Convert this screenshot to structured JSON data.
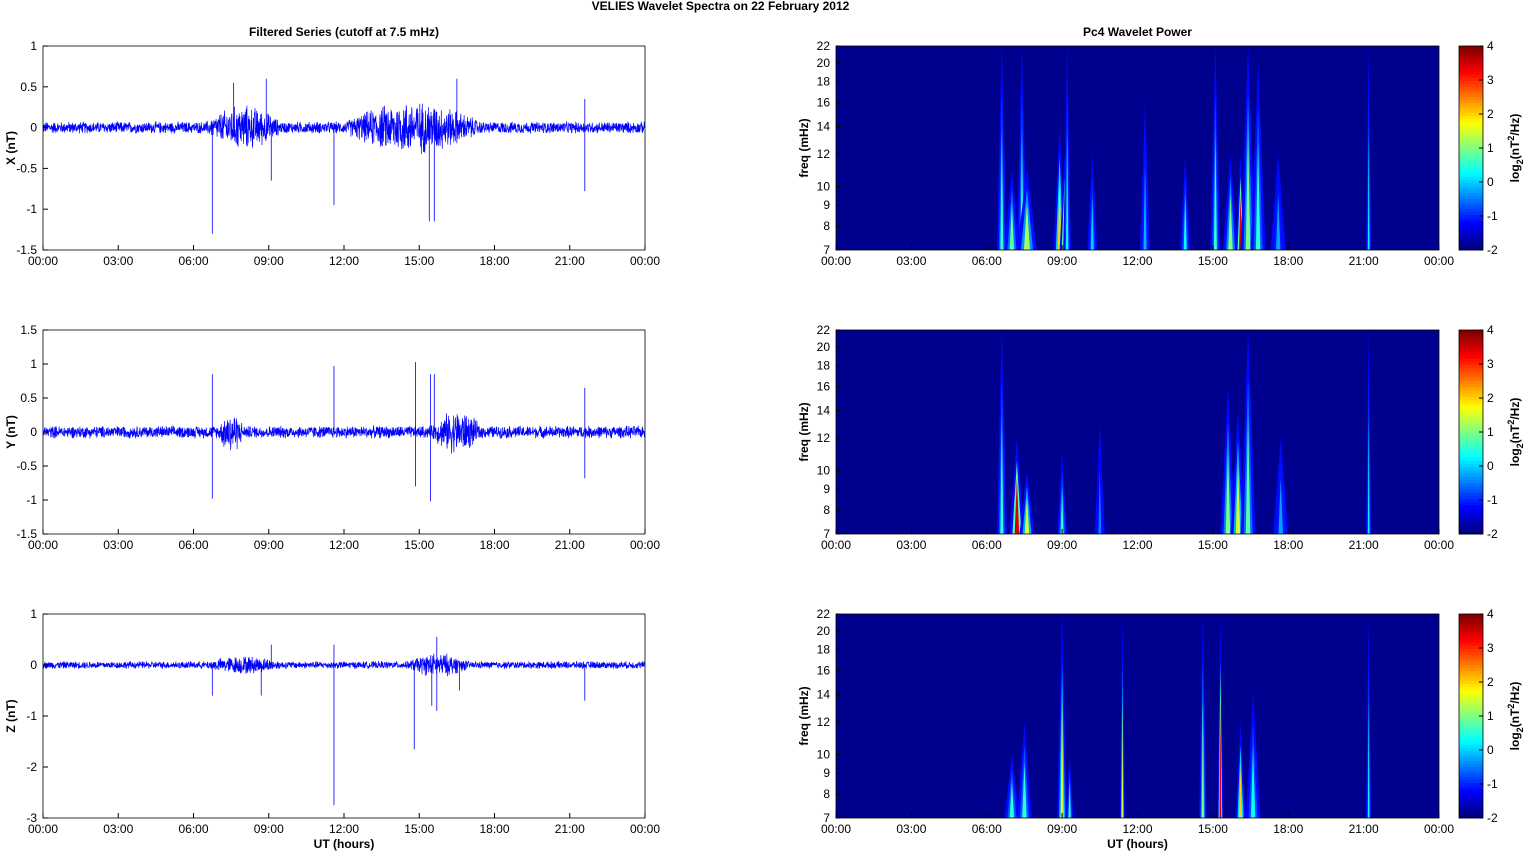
{
  "title": "VELIES Wavelet Spectra on 22 February  2012",
  "chart_data": [
    {
      "type": "line",
      "title": "Filtered Series (cutoff at 7.5 mHz)",
      "ylabel": "X (nT)",
      "xlabel": "",
      "xlim": [
        0,
        24
      ],
      "ylim": [
        -1.5,
        1
      ],
      "yticks": [
        -1.5,
        -1,
        -0.5,
        0,
        0.5,
        1
      ],
      "xticks": [
        "00:00",
        "03:00",
        "06:00",
        "09:00",
        "12:00",
        "15:00",
        "18:00",
        "21:00",
        "00:00"
      ],
      "color": "#0000ff",
      "noise": 0.08,
      "bursts": [
        [
          6.5,
          9.5,
          0.22
        ],
        [
          12,
          17.5,
          0.28
        ]
      ],
      "spikes": [
        [
          6.75,
          -1.3
        ],
        [
          7.6,
          0.55
        ],
        [
          8.9,
          0.6
        ],
        [
          9.1,
          -0.65
        ],
        [
          11.6,
          -0.95
        ],
        [
          15.4,
          -1.15
        ],
        [
          15.6,
          -1.15
        ],
        [
          16.5,
          0.6
        ],
        [
          21.6,
          -0.78
        ],
        [
          21.6,
          0.35
        ]
      ]
    },
    {
      "type": "line",
      "title": "",
      "ylabel": "Y (nT)",
      "xlabel": "",
      "xlim": [
        0,
        24
      ],
      "ylim": [
        -1.5,
        1.5
      ],
      "yticks": [
        -1.5,
        -1,
        -0.5,
        0,
        0.5,
        1,
        1.5
      ],
      "xticks": [
        "00:00",
        "03:00",
        "06:00",
        "09:00",
        "12:00",
        "15:00",
        "18:00",
        "21:00",
        "00:00"
      ],
      "color": "#0000ff",
      "noise": 0.1,
      "bursts": [
        [
          7,
          8,
          0.25
        ],
        [
          15.5,
          17.5,
          0.25
        ]
      ],
      "spikes": [
        [
          6.75,
          0.85
        ],
        [
          6.75,
          -0.98
        ],
        [
          11.6,
          0.97
        ],
        [
          14.85,
          1.03
        ],
        [
          14.85,
          -0.8
        ],
        [
          15.45,
          0.85
        ],
        [
          15.45,
          -1.02
        ],
        [
          15.6,
          0.85
        ],
        [
          21.6,
          0.65
        ],
        [
          21.6,
          -0.68
        ]
      ]
    },
    {
      "type": "line",
      "title": "",
      "ylabel": "Z (nT)",
      "xlabel": "UT (hours)",
      "xlim": [
        0,
        24
      ],
      "ylim": [
        -3,
        1
      ],
      "yticks": [
        -3,
        -2,
        -1,
        0,
        1
      ],
      "xticks": [
        "00:00",
        "03:00",
        "06:00",
        "09:00",
        "12:00",
        "15:00",
        "18:00",
        "21:00",
        "00:00"
      ],
      "color": "#0000ff",
      "noise": 0.08,
      "bursts": [
        [
          6.5,
          9.5,
          0.12
        ],
        [
          14.5,
          17,
          0.18
        ]
      ],
      "spikes": [
        [
          6.75,
          -0.6
        ],
        [
          8.7,
          -0.6
        ],
        [
          9.1,
          0.4
        ],
        [
          11.6,
          -2.75
        ],
        [
          11.6,
          0.4
        ],
        [
          14.8,
          -1.65
        ],
        [
          15.5,
          -0.8
        ],
        [
          15.7,
          -0.9
        ],
        [
          15.7,
          0.55
        ],
        [
          16.6,
          -0.5
        ],
        [
          21.6,
          -0.7
        ]
      ]
    },
    {
      "type": "heatmap",
      "title": "Pc4 Wavelet Power",
      "ylabel": "freq (mHz)",
      "xlabel": "",
      "xlim": [
        0,
        24
      ],
      "ylim": [
        7,
        22
      ],
      "yscale": "log",
      "yticks": [
        7,
        8,
        9,
        10,
        12,
        14,
        16,
        18,
        20,
        22
      ],
      "xticks": [
        "00:00",
        "03:00",
        "06:00",
        "09:00",
        "12:00",
        "15:00",
        "18:00",
        "21:00",
        "00:00"
      ],
      "colorbar": {
        "label": "log2(nT^2/Hz)",
        "range": [
          -2,
          4
        ],
        "ticks": [
          -2,
          -1,
          0,
          1,
          2,
          3,
          4
        ]
      },
      "events": [
        [
          6.6,
          22,
          0.5,
          0.2
        ],
        [
          7.0,
          11,
          0.8,
          0.3
        ],
        [
          7.4,
          22,
          0.5,
          0.2
        ],
        [
          7.6,
          11,
          1.2,
          0.4
        ],
        [
          8.9,
          14,
          2.0,
          0.25
        ],
        [
          9.1,
          12,
          3.5,
          0.2
        ],
        [
          9.2,
          22,
          0.3,
          0.15
        ],
        [
          10.2,
          12,
          0,
          0.2
        ],
        [
          12.3,
          16,
          -0.2,
          0.2
        ],
        [
          13.9,
          12,
          0.3,
          0.2
        ],
        [
          15.1,
          22,
          0.5,
          0.2
        ],
        [
          15.7,
          12,
          1.0,
          0.3
        ],
        [
          16.1,
          12,
          3.5,
          0.2
        ],
        [
          16.4,
          22,
          1.0,
          0.3
        ],
        [
          16.8,
          20,
          0.5,
          0.3
        ],
        [
          17.6,
          12,
          -0.3,
          0.3
        ],
        [
          21.2,
          22,
          0.2,
          0.1
        ]
      ]
    },
    {
      "type": "heatmap",
      "title": "",
      "ylabel": "freq (mHz)",
      "xlabel": "",
      "xlim": [
        0,
        24
      ],
      "ylim": [
        7,
        22
      ],
      "yscale": "log",
      "yticks": [
        7,
        8,
        9,
        10,
        12,
        14,
        16,
        18,
        20,
        22
      ],
      "xticks": [
        "00:00",
        "03:00",
        "06:00",
        "09:00",
        "12:00",
        "15:00",
        "18:00",
        "21:00",
        "00:00"
      ],
      "colorbar": {
        "label": "log2(nT^2/Hz)",
        "range": [
          -2,
          4
        ],
        "ticks": [
          -2,
          -1,
          0,
          1,
          2,
          3,
          4
        ]
      },
      "events": [
        [
          6.6,
          22,
          0.5,
          0.2
        ],
        [
          7.2,
          12,
          3.5,
          0.3
        ],
        [
          7.6,
          10,
          1.5,
          0.3
        ],
        [
          9.0,
          11,
          0.5,
          0.2
        ],
        [
          10.5,
          13,
          -0.5,
          0.2
        ],
        [
          15.6,
          16,
          1.0,
          0.3
        ],
        [
          16.0,
          14,
          1.5,
          0.3
        ],
        [
          16.4,
          22,
          0.8,
          0.3
        ],
        [
          17.7,
          12,
          -0.3,
          0.3
        ],
        [
          21.2,
          22,
          0.2,
          0.1
        ]
      ]
    },
    {
      "type": "heatmap",
      "title": "",
      "ylabel": "freq (mHz)",
      "xlabel": "UT (hours)",
      "xlim": [
        0,
        24
      ],
      "ylim": [
        7,
        22
      ],
      "yscale": "log",
      "yticks": [
        7,
        8,
        9,
        10,
        12,
        14,
        16,
        18,
        20,
        22
      ],
      "xticks": [
        "00:00",
        "03:00",
        "06:00",
        "09:00",
        "12:00",
        "15:00",
        "18:00",
        "21:00",
        "00:00"
      ],
      "colorbar": {
        "label": "log2(nT^2/Hz)",
        "range": [
          -2,
          4
        ],
        "ticks": [
          -2,
          -1,
          0,
          1,
          2,
          3,
          4
        ]
      },
      "events": [
        [
          7.0,
          10,
          0.5,
          0.3
        ],
        [
          7.5,
          12,
          0.5,
          0.3
        ],
        [
          9.0,
          22,
          1.5,
          0.2
        ],
        [
          9.3,
          10,
          0.5,
          0.15
        ],
        [
          11.4,
          22,
          1.5,
          0.1
        ],
        [
          14.6,
          22,
          1.0,
          0.15
        ],
        [
          15.3,
          22,
          3.5,
          0.12
        ],
        [
          16.1,
          12,
          2.0,
          0.2
        ],
        [
          16.6,
          14,
          0.3,
          0.3
        ],
        [
          21.2,
          22,
          0.3,
          0.1
        ]
      ]
    }
  ]
}
